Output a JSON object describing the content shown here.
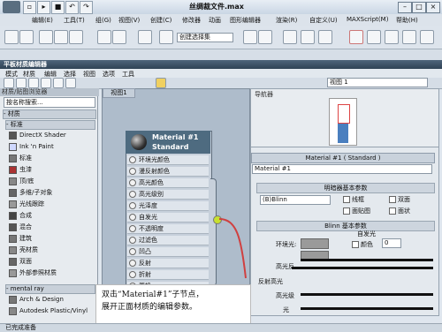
{
  "app": {
    "file_title": "丝绸裁文件.max",
    "menu": [
      "编辑(E)",
      "工具(T)",
      "组(G)",
      "视图(V)",
      "创建(C)",
      "修改器",
      "动画",
      "图形编辑器",
      "渲染(R)",
      "自定义(U)",
      "MAXScript(M)",
      "帮助(H)"
    ],
    "selection_placeholder": "创建选择集"
  },
  "material_editor": {
    "title": "平板材质编辑器",
    "menu": [
      "模式",
      "材质",
      "编辑",
      "选择",
      "视图",
      "选项",
      "工具"
    ],
    "browser_header": "材质/贴图浏览器",
    "search_placeholder": "按名称搜索...",
    "section_materials": "- 材质",
    "subsection_standard": "- 标准",
    "standard_items": [
      {
        "label": "DirectX Shader",
        "swatch": "#555555"
      },
      {
        "label": "Ink 'n Paint",
        "swatch": "#cfd8ff"
      },
      {
        "label": "标准",
        "swatch": "#777777"
      },
      {
        "label": "虫漆",
        "swatch": "#aa3333"
      },
      {
        "label": "顶/底",
        "swatch": "#888888"
      },
      {
        "label": "多维/子对象",
        "swatch": "#666666"
      },
      {
        "label": "光线跟踪",
        "swatch": "#999999"
      },
      {
        "label": "合成",
        "swatch": "#444444"
      },
      {
        "label": "混合",
        "swatch": "#555555"
      },
      {
        "label": "建筑",
        "swatch": "#777777"
      },
      {
        "label": "壳材质",
        "swatch": "#888888"
      },
      {
        "label": "双面",
        "swatch": "#666666"
      },
      {
        "label": "外部参照材质",
        "swatch": "#999999"
      }
    ],
    "subsection_mentalray": "- mental ray",
    "mentalray_items": [
      {
        "label": "Arch & Design",
        "swatch": "#777777"
      },
      {
        "label": "Autodesk Plastic/Vinyl",
        "swatch": "#888888"
      }
    ],
    "view_tab": "视图1",
    "view_select": "视图 1",
    "navigator_label": "导航器",
    "node": {
      "name": "Material #1",
      "type": "Standard",
      "slots": [
        "环境光颜色",
        "漫反射颜色",
        "高光颜色",
        "高光级别",
        "光泽度",
        "自发光",
        "不透明度",
        "过滤色",
        "凹凸",
        "反射",
        "折射",
        "置换"
      ]
    },
    "params": {
      "header": "Material #1  ( Standard )",
      "name_field": "Material #1",
      "shader_group": "明暗器基本参数",
      "shader_value": "(B)Blinn",
      "checkboxes": [
        "线框",
        "双面",
        "面贴图",
        "面状"
      ],
      "blinn_group": "Blinn 基本参数",
      "self_illum_label": "自发光",
      "ambient_label": "环境光:",
      "color_label": "颜色",
      "color_value": "0",
      "specular_label": "高光反",
      "highlight_section": "反射高光",
      "highlight_level": "高光级",
      "glossiness": "光"
    },
    "status_text": "已完成准备"
  },
  "caption": {
    "line1": "双击“Material#1”子节点，",
    "line2": "展开正面材质的编辑参数。"
  }
}
